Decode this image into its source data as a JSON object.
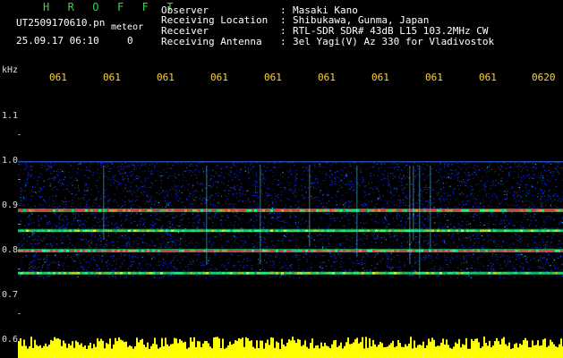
{
  "header": {
    "title": "H R O F F T",
    "filename": "UT2509170610.pn",
    "meteor_label": "meteor",
    "timestamp": "25.09.17 06:10",
    "counter": "0",
    "info": [
      {
        "label": "Observer",
        "value": "Masaki Kano"
      },
      {
        "label": "Receiving Location",
        "value": "Shibukawa, Gunma, Japan"
      },
      {
        "label": "Receiver",
        "value": "RTL-SDR SDR# 43dB L15 103.2MHz CW"
      },
      {
        "label": "Receiving Antenna",
        "value": "3el Yagi(V) Az 330 for Vladivostok"
      }
    ],
    "colon": ":"
  },
  "axis": {
    "y_unit": "kHz",
    "y_ticks": [
      "1.1",
      "1.0",
      "0.9",
      "0.8",
      "0.7",
      "0.6"
    ],
    "time_ticks": [
      "061",
      "061",
      "061",
      "061",
      "061",
      "061",
      "061",
      "061",
      "061",
      "0620"
    ]
  },
  "colors": {
    "background": "#000000",
    "title": "#37d24a",
    "time_labels": "#ffd43b",
    "activity_bar": "#ffff00",
    "signal_strong": "#ff3344",
    "signal_mid": "#22ff88",
    "noise": "#1a35ff"
  },
  "chart_data": {
    "type": "heatmap",
    "ylabel": "kHz",
    "ylim": [
      0.6,
      1.15
    ],
    "signal_lines_khz": [
      0.93,
      0.885,
      0.84,
      0.79
    ]
  }
}
